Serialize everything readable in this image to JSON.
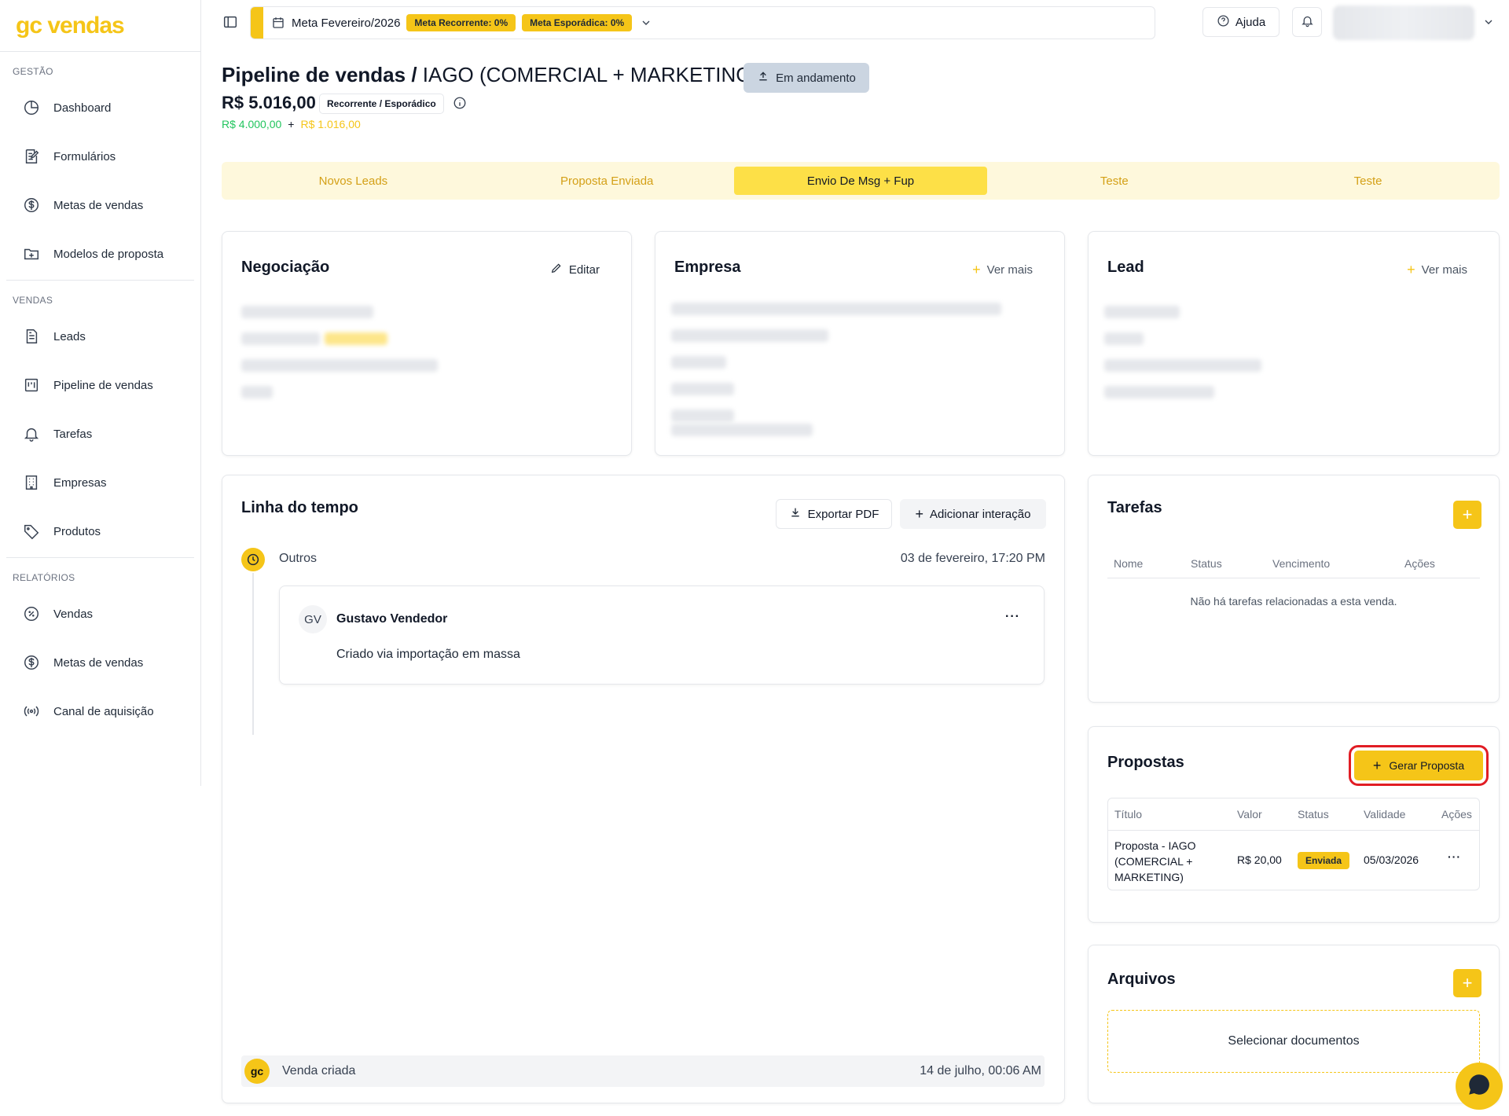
{
  "brand": {
    "logo": "gc vendas"
  },
  "sidebar": {
    "sections": [
      {
        "title": "GESTÃO",
        "items": [
          {
            "label": "Dashboard",
            "icon": "dashboard-icon"
          },
          {
            "label": "Formulários",
            "icon": "form-icon"
          },
          {
            "label": "Metas de vendas",
            "icon": "dollar-circle-icon"
          },
          {
            "label": "Modelos de proposta",
            "icon": "folder-plus-icon"
          }
        ]
      },
      {
        "title": "VENDAS",
        "items": [
          {
            "label": "Leads",
            "icon": "document-icon"
          },
          {
            "label": "Pipeline de vendas",
            "icon": "kanban-icon"
          },
          {
            "label": "Tarefas",
            "icon": "bell-icon"
          },
          {
            "label": "Empresas",
            "icon": "building-icon"
          },
          {
            "label": "Produtos",
            "icon": "tag-icon"
          }
        ]
      },
      {
        "title": "RELATÓRIOS",
        "items": [
          {
            "label": "Vendas",
            "icon": "percent-circle-icon"
          },
          {
            "label": "Metas de vendas",
            "icon": "dollar-circle-icon"
          },
          {
            "label": "Canal de aquisição",
            "icon": "broadcast-icon"
          }
        ]
      }
    ]
  },
  "topbar": {
    "meta_title": "Meta Fevereiro/2026",
    "meta_recorrente": "Meta Recorrente: 0%",
    "meta_esporadica": "Meta Esporádica: 0%",
    "help_label": "Ajuda"
  },
  "header": {
    "title_bold": "Pipeline de vendas /",
    "title_rest": " IAGO (COMERCIAL + MARKETING)",
    "status_label": "Em andamento",
    "amount": "R$ 5.016,00",
    "type_badge": "Recorrente / Esporádico",
    "recorrente": "R$ 4.000,00",
    "plus": "+",
    "esporadico": "R$ 1.016,00"
  },
  "stages": [
    {
      "label": "Novos Leads",
      "active": false
    },
    {
      "label": "Proposta Enviada",
      "active": false
    },
    {
      "label": "Envio De Msg + Fup",
      "active": true
    },
    {
      "label": "Teste",
      "active": false
    },
    {
      "label": "Teste",
      "active": false
    }
  ],
  "negociacao": {
    "title": "Negociação",
    "edit_label": "Editar"
  },
  "empresa": {
    "title": "Empresa",
    "more_label": "Ver mais"
  },
  "lead": {
    "title": "Lead",
    "more_label": "Ver mais"
  },
  "timeline": {
    "title": "Linha do tempo",
    "export_label": "Exportar PDF",
    "add_label": "Adicionar interação",
    "entry": {
      "type": "Outros",
      "date": "03 de fevereiro, 17:20 PM",
      "initials": "GV",
      "author": "Gustavo Vendedor",
      "more": "···",
      "text": "Criado via importação em massa"
    },
    "footer": {
      "badge": "gc",
      "label": "Venda criada",
      "date": "14 de julho, 00:06 AM"
    }
  },
  "tarefas": {
    "title": "Tarefas",
    "columns": [
      "Nome",
      "Status",
      "Vencimento",
      "Ações"
    ],
    "empty": "Não há tarefas relacionadas a esta venda."
  },
  "propostas": {
    "title": "Propostas",
    "button_label": "Gerar Proposta",
    "columns": [
      "Título",
      "Valor",
      "Status",
      "Validade",
      "Ações"
    ],
    "rows": [
      {
        "title_lines": [
          "Proposta - IAGO",
          "(COMERCIAL +",
          "MARKETING)"
        ],
        "valor": "R$ 20,00",
        "status": "Enviada",
        "validade": "05/03/2026",
        "acoes": "···"
      }
    ]
  },
  "arquivos": {
    "title": "Arquivos",
    "upload_label": "Selecionar documentos"
  },
  "colors": {
    "accent": "#f5c518",
    "stage_bg": "#fef8dc",
    "stage_active": "#fde047",
    "green": "#22c55e",
    "highlight": "#e11d24"
  }
}
